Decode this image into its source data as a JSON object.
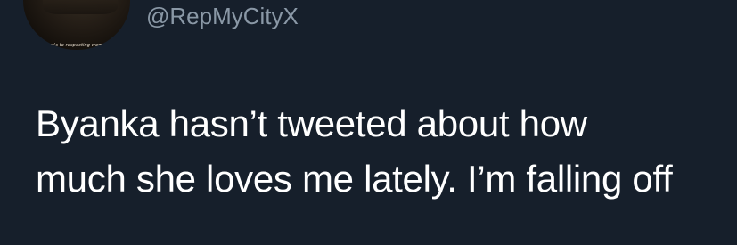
{
  "author": {
    "handle": "@RepMyCityX",
    "avatar_caption": "...re's to respecting women"
  },
  "tweet": {
    "lines": [
      "Byanka hasn’t tweeted about how",
      "much she loves me lately. I’m falling off"
    ]
  },
  "colors": {
    "background": "#161f2b",
    "text": "#ffffff",
    "handle": "#8a98a6"
  }
}
